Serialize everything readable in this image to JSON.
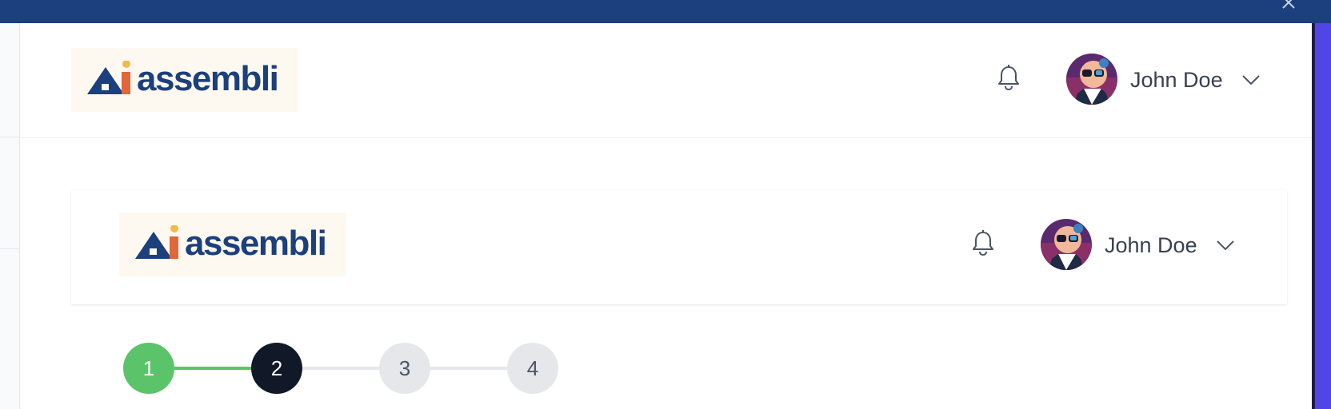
{
  "brand": {
    "name": "assembli",
    "primary_color": "#1c3f7d",
    "accent_color": "#f5b94a",
    "logo_background": "#fdf9f0"
  },
  "header": {
    "notifications_icon": "bell-icon",
    "user": {
      "name": "John Doe",
      "avatar": "cartoon-avatar",
      "menu_icon": "chevron-down-icon"
    }
  },
  "preview_header": {
    "notifications_icon": "bell-icon",
    "user": {
      "name": "John Doe",
      "avatar": "cartoon-avatar",
      "menu_icon": "chevron-down-icon"
    }
  },
  "stepper": {
    "steps": [
      {
        "label": "1",
        "state": "complete"
      },
      {
        "label": "2",
        "state": "current"
      },
      {
        "label": "3",
        "state": "upcoming"
      },
      {
        "label": "4",
        "state": "upcoming"
      }
    ],
    "colors": {
      "complete": "#5bc46a",
      "current": "#111827",
      "upcoming": "#e5e7eb"
    }
  },
  "window": {
    "close_icon": "close-icon",
    "top_bar_color": "#1c3f7d"
  }
}
